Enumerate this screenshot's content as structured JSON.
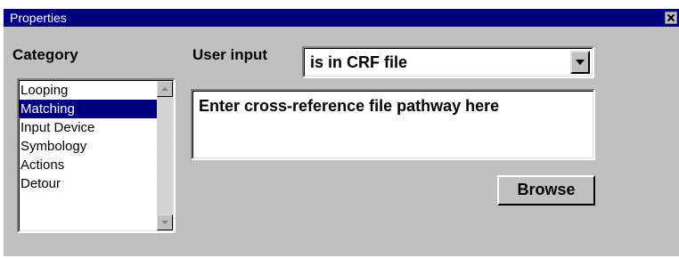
{
  "window": {
    "title": "Properties"
  },
  "category": {
    "label": "Category",
    "items": [
      {
        "label": "Looping",
        "selected": false
      },
      {
        "label": "Matching",
        "selected": true
      },
      {
        "label": "Input Device",
        "selected": false
      },
      {
        "label": "Symbology",
        "selected": false
      },
      {
        "label": "Actions",
        "selected": false
      },
      {
        "label": "Detour",
        "selected": false
      }
    ]
  },
  "user_input": {
    "label": "User input",
    "selected_value": "is in CRF file"
  },
  "pathway": {
    "value": "Enter cross-reference file pathway here"
  },
  "browse_button": {
    "label": "Browse"
  },
  "colors": {
    "titlebar": "#000080",
    "face": "#c0c0c0",
    "selection": "#000080"
  },
  "icons": {
    "close": "close-icon",
    "dropdown": "chevron-down-icon",
    "scroll_up": "arrow-up-icon",
    "scroll_down": "arrow-down-icon"
  }
}
